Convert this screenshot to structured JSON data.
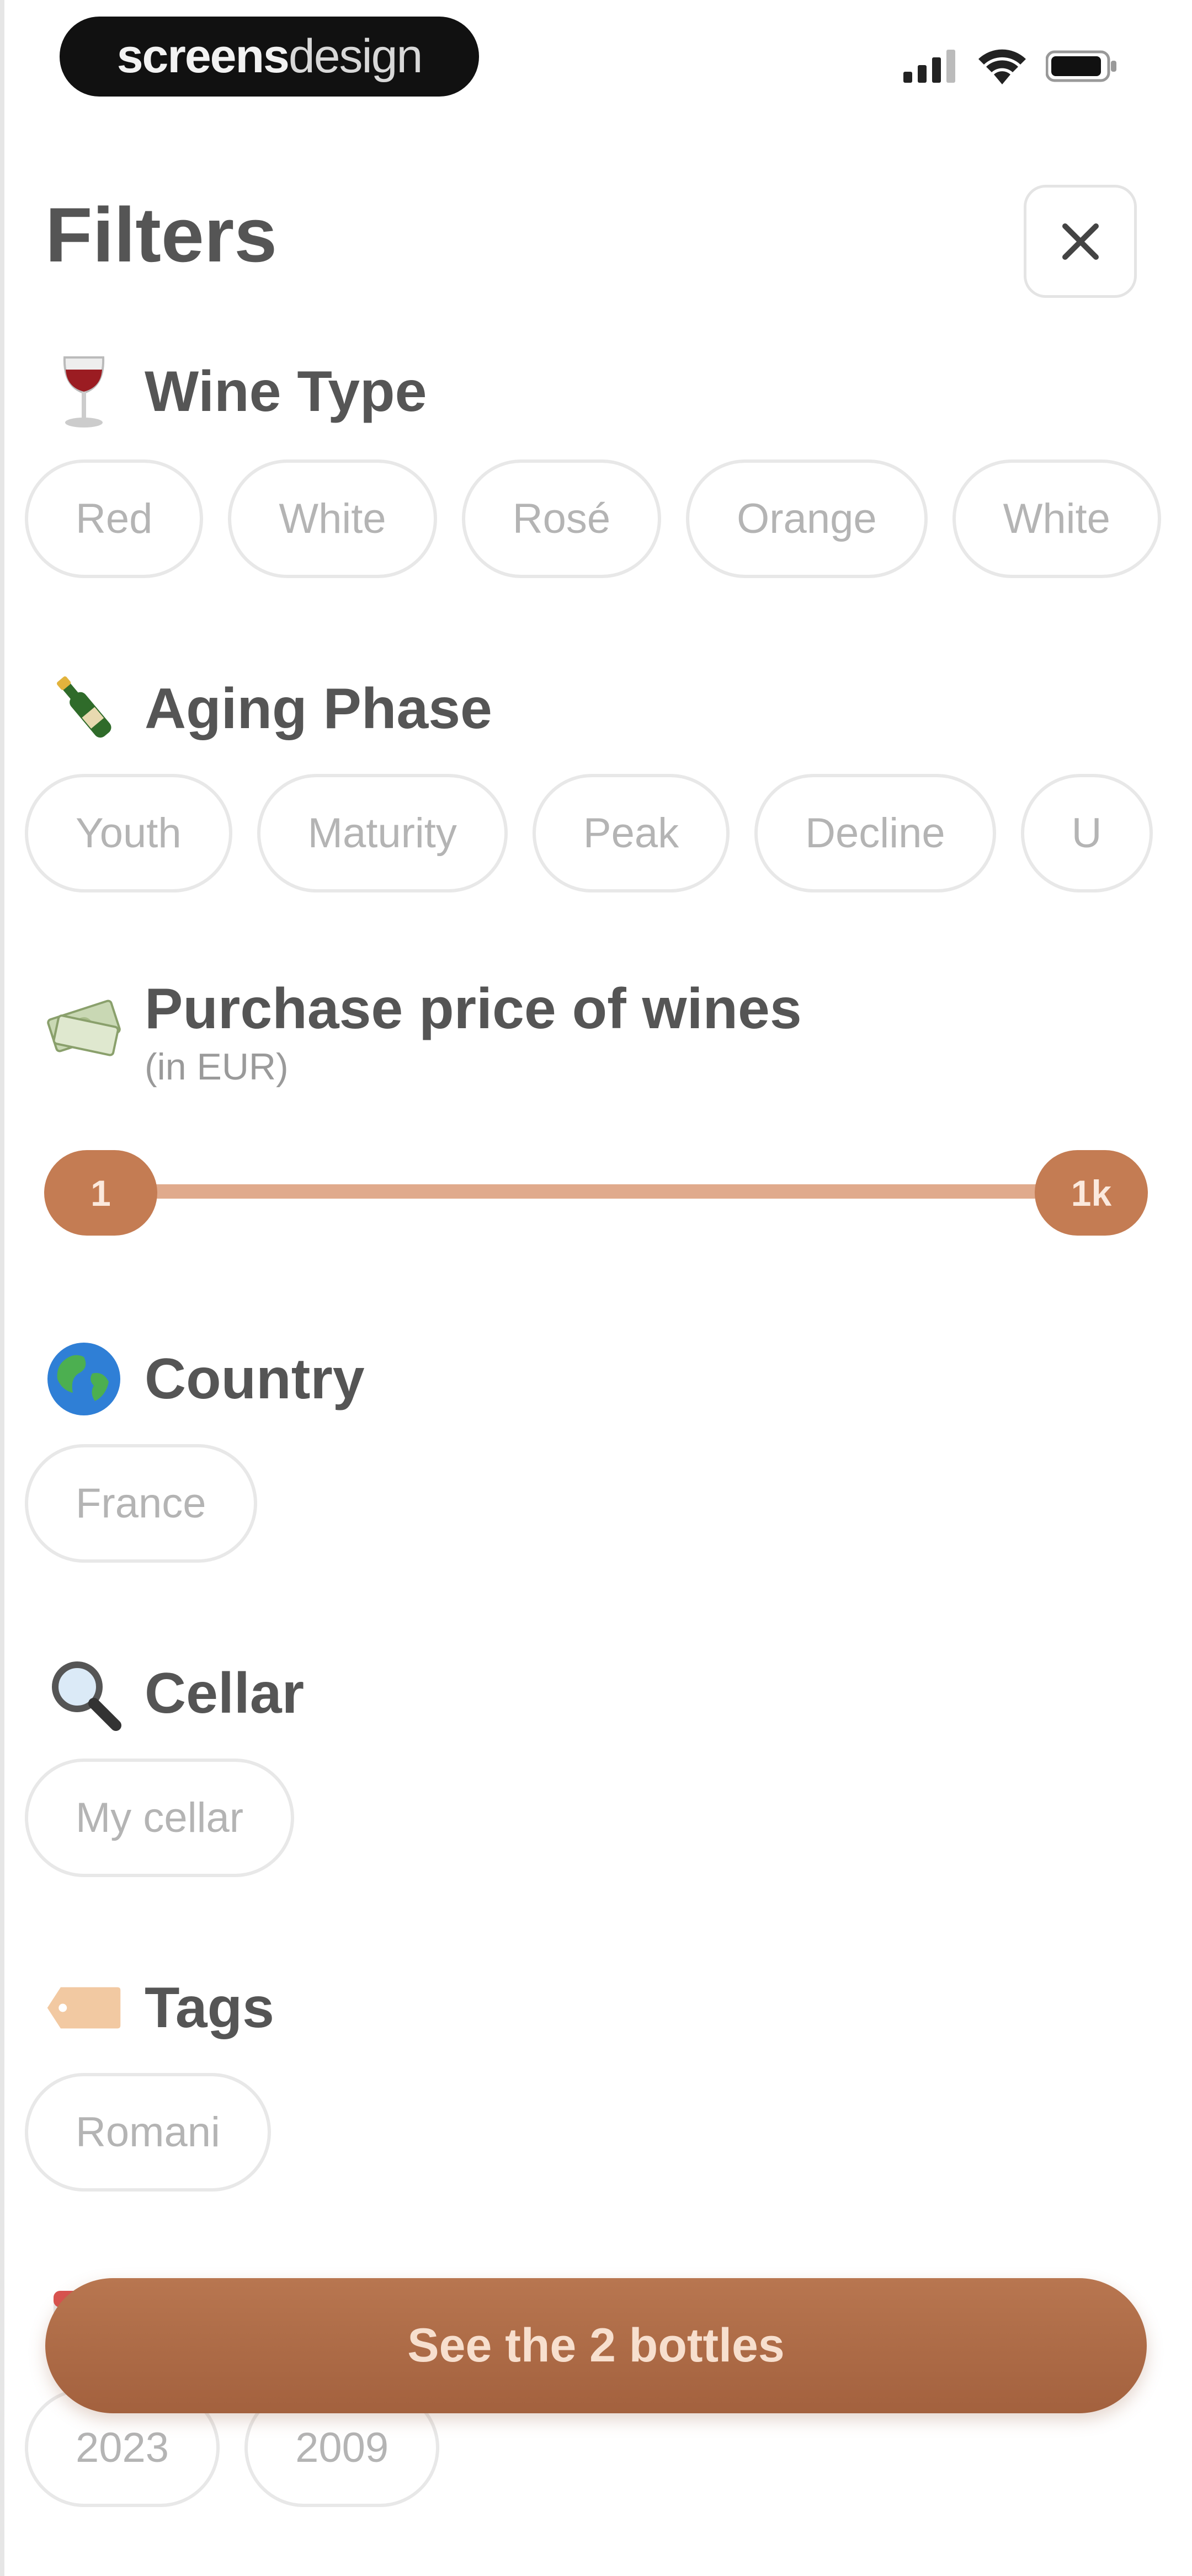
{
  "status_bar": {
    "brand_bold": "screens",
    "brand_light": "design"
  },
  "header": {
    "title": "Filters"
  },
  "colors": {
    "accent": "#c47c53",
    "accent_dark": "#a3613e",
    "chip_border": "#e8e8e8",
    "chip_text": "#b4b4b4"
  },
  "sections": {
    "wine_type": {
      "title": "Wine Type",
      "icon": "wine-glass-icon",
      "chips": [
        "Red",
        "White",
        "Rosé",
        "Orange",
        "White"
      ]
    },
    "aging_phase": {
      "title": "Aging Phase",
      "icon": "champagne-bottle-icon",
      "chips": [
        "Youth",
        "Maturity",
        "Peak",
        "Decline",
        "U"
      ]
    },
    "price": {
      "title": "Purchase price of wines",
      "subtitle": "(in EUR)",
      "icon": "money-icon",
      "min_label": "1",
      "max_label": "1k"
    },
    "country": {
      "title": "Country",
      "icon": "globe-icon",
      "chips": [
        "France"
      ]
    },
    "cellar": {
      "title": "Cellar",
      "icon": "magnifier-icon",
      "chips": [
        "My cellar"
      ]
    },
    "tags": {
      "title": "Tags",
      "icon": "tag-icon",
      "chips": [
        "Romani"
      ]
    },
    "vintage": {
      "icon": "calendar-icon",
      "chips": [
        "2023",
        "2009"
      ]
    }
  },
  "cta": {
    "label": "See the 2 bottles"
  }
}
